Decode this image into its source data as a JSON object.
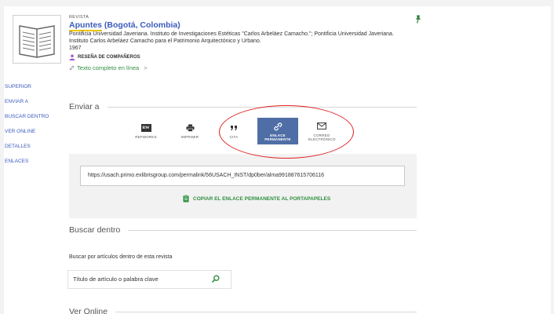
{
  "record": {
    "type": "REVISTA",
    "title_highlight": "Apuntes",
    "title_rest": " (Bogotá, Colombia)",
    "publisher": "Pontificia Universidad Javeriana. Instituto de Investigaciones Estéticas \"Carlos Arbeláez Camacho.\"; Pontificia Universidad Javeriana. Instituto Carlos Arbeláez Camacho para el Patrimonio Arquitectónico y Urbano.",
    "year": "1967",
    "peer_review": "RESEÑA DE COMPAÑEROS",
    "full_text": "Texto completo en línea",
    "full_text_arrow": ">"
  },
  "sidebar": {
    "items": [
      "SUPERIOR",
      "ENVIAR A",
      "BUSCAR DENTRO",
      "VER ONLINE",
      "DETALLES",
      "ENLACES"
    ]
  },
  "send_to": {
    "heading": "Enviar a",
    "actions": [
      {
        "label": "REFWORKS",
        "icon": "refworks-icon"
      },
      {
        "label": "IMPRIMIR",
        "icon": "printer-icon"
      },
      {
        "label": "CITA",
        "icon": "quote-icon"
      },
      {
        "label": "ENLACE PERMANENTE",
        "icon": "link-icon",
        "active": true
      },
      {
        "label": "CORREO ELECTRÓNICO",
        "icon": "mail-icon"
      }
    ],
    "refworks_glyph": "RW",
    "permalink": "https://usach.primo.exlibrisgroup.com/permalink/56USACH_INST/dp0ber/alma991887615706116",
    "copy_label": "COPIAR EL ENLACE PERMANENTE AL PORTAPAPELES"
  },
  "search_inside": {
    "heading": "Buscar dentro",
    "description": "Buscar por artículos dentro de esta revista",
    "placeholder": "Título de artículo o palabra clave"
  },
  "view_online": {
    "heading": "Ver Online"
  },
  "colors": {
    "link_blue": "#3b5bbd",
    "green": "#2f8f3f",
    "active_tile": "#4f6ea6",
    "annotation_red": "#e02020"
  }
}
